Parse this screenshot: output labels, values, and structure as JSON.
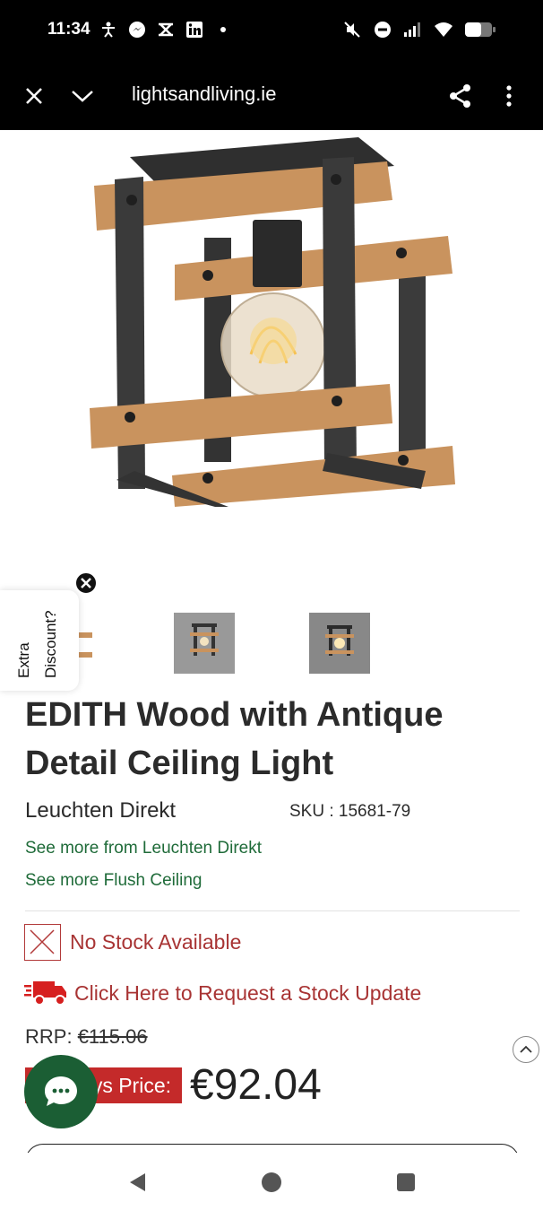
{
  "status_bar": {
    "time": "11:34",
    "left_icons": [
      "accessibility-icon",
      "messenger-icon",
      "stack-icon",
      "linkedin-icon",
      "dot-icon"
    ],
    "right_icons": [
      "mute-icon",
      "dnd-icon",
      "signal-icon",
      "wifi-icon",
      "battery-icon"
    ]
  },
  "browser": {
    "url": "lightsandliving.ie"
  },
  "discount_tab": {
    "label": "Extra Discount?"
  },
  "product": {
    "title": "EDITH Wood with Antique Detail Ceiling Light",
    "brand": "Leuchten Direkt",
    "sku_label": "SKU : 15681-79",
    "link_brand": "See more from Leuchten Direkt",
    "link_category": "See more Flush Ceiling",
    "stock_status": "No Stock Available",
    "stock_request": "Click Here to Request a Stock Update",
    "rrp_label": "RRP:",
    "rrp_value": "€115.06",
    "price_badge": "ys Price:",
    "price": "€92.04"
  },
  "colors": {
    "link_green": "#1f6b39",
    "stock_red": "#a83434",
    "badge_red": "#c42a2a",
    "chat_green": "#1b5e34",
    "wood": "#c9935e",
    "metal": "#3a3a3a"
  }
}
